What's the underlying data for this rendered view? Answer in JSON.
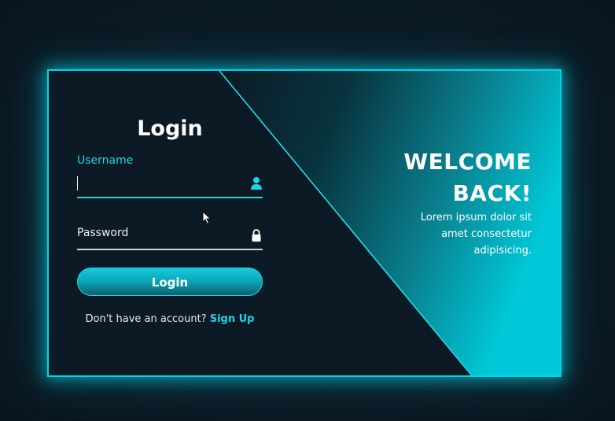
{
  "login_form": {
    "title": "Login",
    "username_label": "Username",
    "password_placeholder": "Password",
    "login_button_label": "Login",
    "signup_prompt": "Don't have an account?",
    "signup_link": "Sign Up",
    "user_icon": "user-icon",
    "lock_icon": "lock-icon"
  },
  "welcome_panel": {
    "heading_line1": "WELCOME",
    "heading_line2": "BACK!",
    "description_line1": "Lorem ipsum dolor sit",
    "description_line2": "amet consectetur",
    "description_line3": "adipisicing."
  },
  "colors": {
    "accent": "#1fd3e3",
    "background": "#0b1a24",
    "glow": "#00d4e6"
  }
}
